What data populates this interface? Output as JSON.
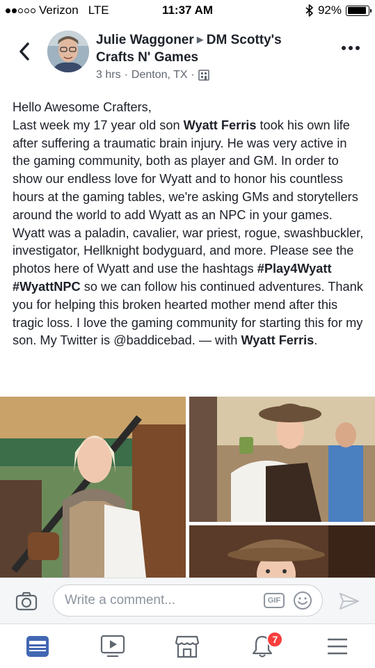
{
  "status_bar": {
    "carrier": "Verizon",
    "network": "LTE",
    "time": "11:37 AM",
    "battery_level": "92%",
    "battery_fraction": 0.92
  },
  "post": {
    "author": "Julie Waggoner",
    "group": "DM Scotty's Crafts N' Games",
    "time_ago": "3 hrs",
    "location": "Denton, TX",
    "separator": "·",
    "body_segments": [
      {
        "text": "Hello Awesome Crafters,\nLast week my 17 year old son ",
        "bold": false
      },
      {
        "text": "Wyatt Ferris",
        "bold": true
      },
      {
        "text": " took his own life after suffering a traumatic brain injury. He was very active in the gaming community,  both as player and GM. In order to show our endless love for Wyatt and to honor his countless hours at the gaming tables, we're asking GMs and storytellers around the world to add Wyatt as an NPC in your games.  Wyatt was a paladin, cavalier, war priest, rogue, swashbuckler, investigator, Hellknight bodyguard, and more. Please see the photos here of Wyatt and use the hashtags ",
        "bold": false
      },
      {
        "text": "#Play4Wyatt",
        "bold": true
      },
      {
        "text": " ",
        "bold": false
      },
      {
        "text": "#WyattNPC",
        "bold": true
      },
      {
        "text": " so we can follow his continued adventures. Thank you for helping this broken hearted mother mend after this tragic loss. I love the gaming community for starting this for my son. My Twitter is @baddicebad. — with ",
        "bold": false
      },
      {
        "text": "Wyatt Ferris",
        "bold": true
      },
      {
        "text": ".",
        "bold": false
      }
    ]
  },
  "comment_bar": {
    "placeholder": "Write a comment...",
    "gif_label": "GIF"
  },
  "tab_bar": {
    "notification_count": "7",
    "accent_color": "#4267b2"
  },
  "icons": [
    "chevron-left-icon",
    "more-icon",
    "globe-building-icon",
    "camera-icon",
    "gif-icon",
    "emoji-icon",
    "send-icon",
    "news-feed-icon",
    "video-icon",
    "marketplace-icon",
    "bell-icon",
    "menu-icon"
  ]
}
